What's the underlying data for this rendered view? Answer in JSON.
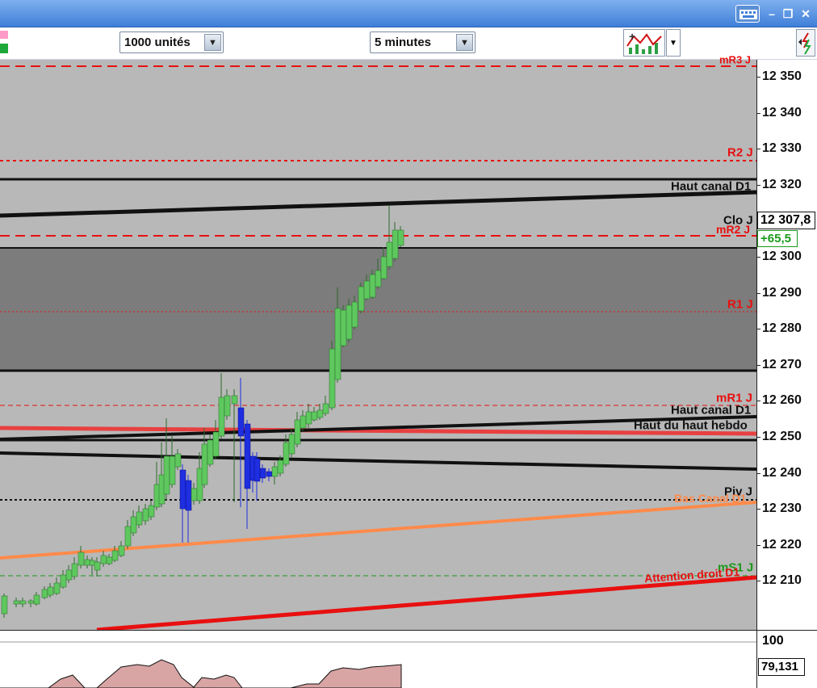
{
  "toolbar": {
    "units_label": "1000 unités",
    "timeframe_label": "5 minutes"
  },
  "price_axis": {
    "ticks": [
      "12 350",
      "12 340",
      "12 330",
      "12 320",
      "12 310",
      "12 300",
      "12 290",
      "12 280",
      "12 270",
      "12 260",
      "12 250",
      "12 240",
      "12 230",
      "12 220",
      "12 210"
    ],
    "current_price": "12 307,8",
    "change": "+65,5",
    "change_color": "#1a9a1a"
  },
  "levels": {
    "mr3": "mR3 J",
    "r2": "R2 J",
    "haut_canal_d1_top": "Haut canal D1",
    "clo": "Clo J",
    "mr2": "mR2 J",
    "r1": "R1 J",
    "mr1": "mR1 J",
    "haut_canal_d1_mid": "Haut canal D1",
    "haut_hebdo": "Haut du haut hebdo",
    "piv": "Piv J",
    "bas_canal": "Bas Canal D1",
    "ms1": "mS1 J",
    "attention": "Attention droit D1"
  },
  "indicator": {
    "top_tick": "100",
    "value": "79,131"
  },
  "colors": {
    "up_candle": "#5ec85e",
    "down_candle": "#1e2ee0",
    "background": "#b8b8b8",
    "band_dark": "#7c7c7c",
    "resistance": "#e81010",
    "support": "#1a9a1a",
    "orange_trend": "#ff8a4a"
  }
}
